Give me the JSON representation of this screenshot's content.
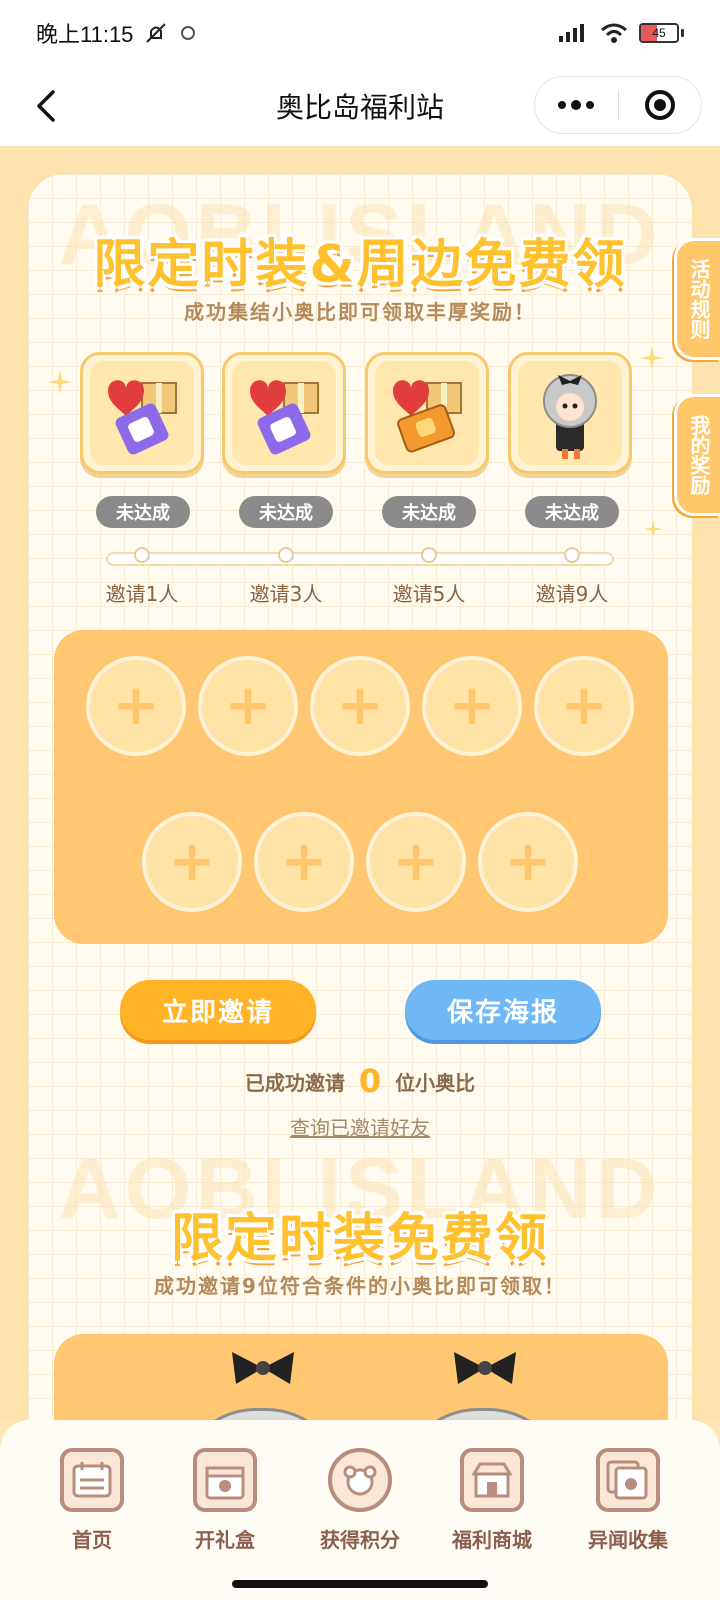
{
  "status_bar": {
    "time": "晚上11:15",
    "battery": "45",
    "battery_level": 0.45
  },
  "nav": {
    "title": "奥比岛福利站"
  },
  "watermark": "AOBI ISLAND",
  "section1": {
    "title": "限定时装&周边免费领",
    "subtitle": "成功集结小奥比即可领取丰厚奖励！",
    "rewards": [
      {
        "status": "未达成",
        "invite": "邀请1人",
        "icon": "gift-heart-badge-purple"
      },
      {
        "status": "未达成",
        "invite": "邀请3人",
        "icon": "gift-heart-badge-purple"
      },
      {
        "status": "未达成",
        "invite": "邀请5人",
        "icon": "gift-heart-card-orange"
      },
      {
        "status": "未达成",
        "invite": "邀请9人",
        "icon": "avatar-costume"
      }
    ],
    "slots_count": 9,
    "slot_symbol": "+",
    "invite_button": "立即邀请",
    "poster_button": "保存海报",
    "invited_prefix": "已成功邀请",
    "invited_count": "0",
    "invited_suffix": "位小奥比",
    "query_link": "查询已邀请好友"
  },
  "section2": {
    "title": "限定时装免费领",
    "subtitle": "成功邀请9位符合条件的小奥比即可领取！"
  },
  "side_tabs": {
    "rules": "活动规则",
    "my_rewards": "我的奖励"
  },
  "tabbar": [
    {
      "label": "首页",
      "icon": "calendar-icon"
    },
    {
      "label": "开礼盒",
      "icon": "gift-box-icon"
    },
    {
      "label": "获得积分",
      "icon": "bear-coin-icon"
    },
    {
      "label": "福利商城",
      "icon": "shop-icon"
    },
    {
      "label": "异闻收集",
      "icon": "collection-icon"
    }
  ],
  "colors": {
    "accent": "#ffb326",
    "poster": "#6fb7f5",
    "panel": "#ffc771",
    "badge": "#8a8a8a"
  }
}
